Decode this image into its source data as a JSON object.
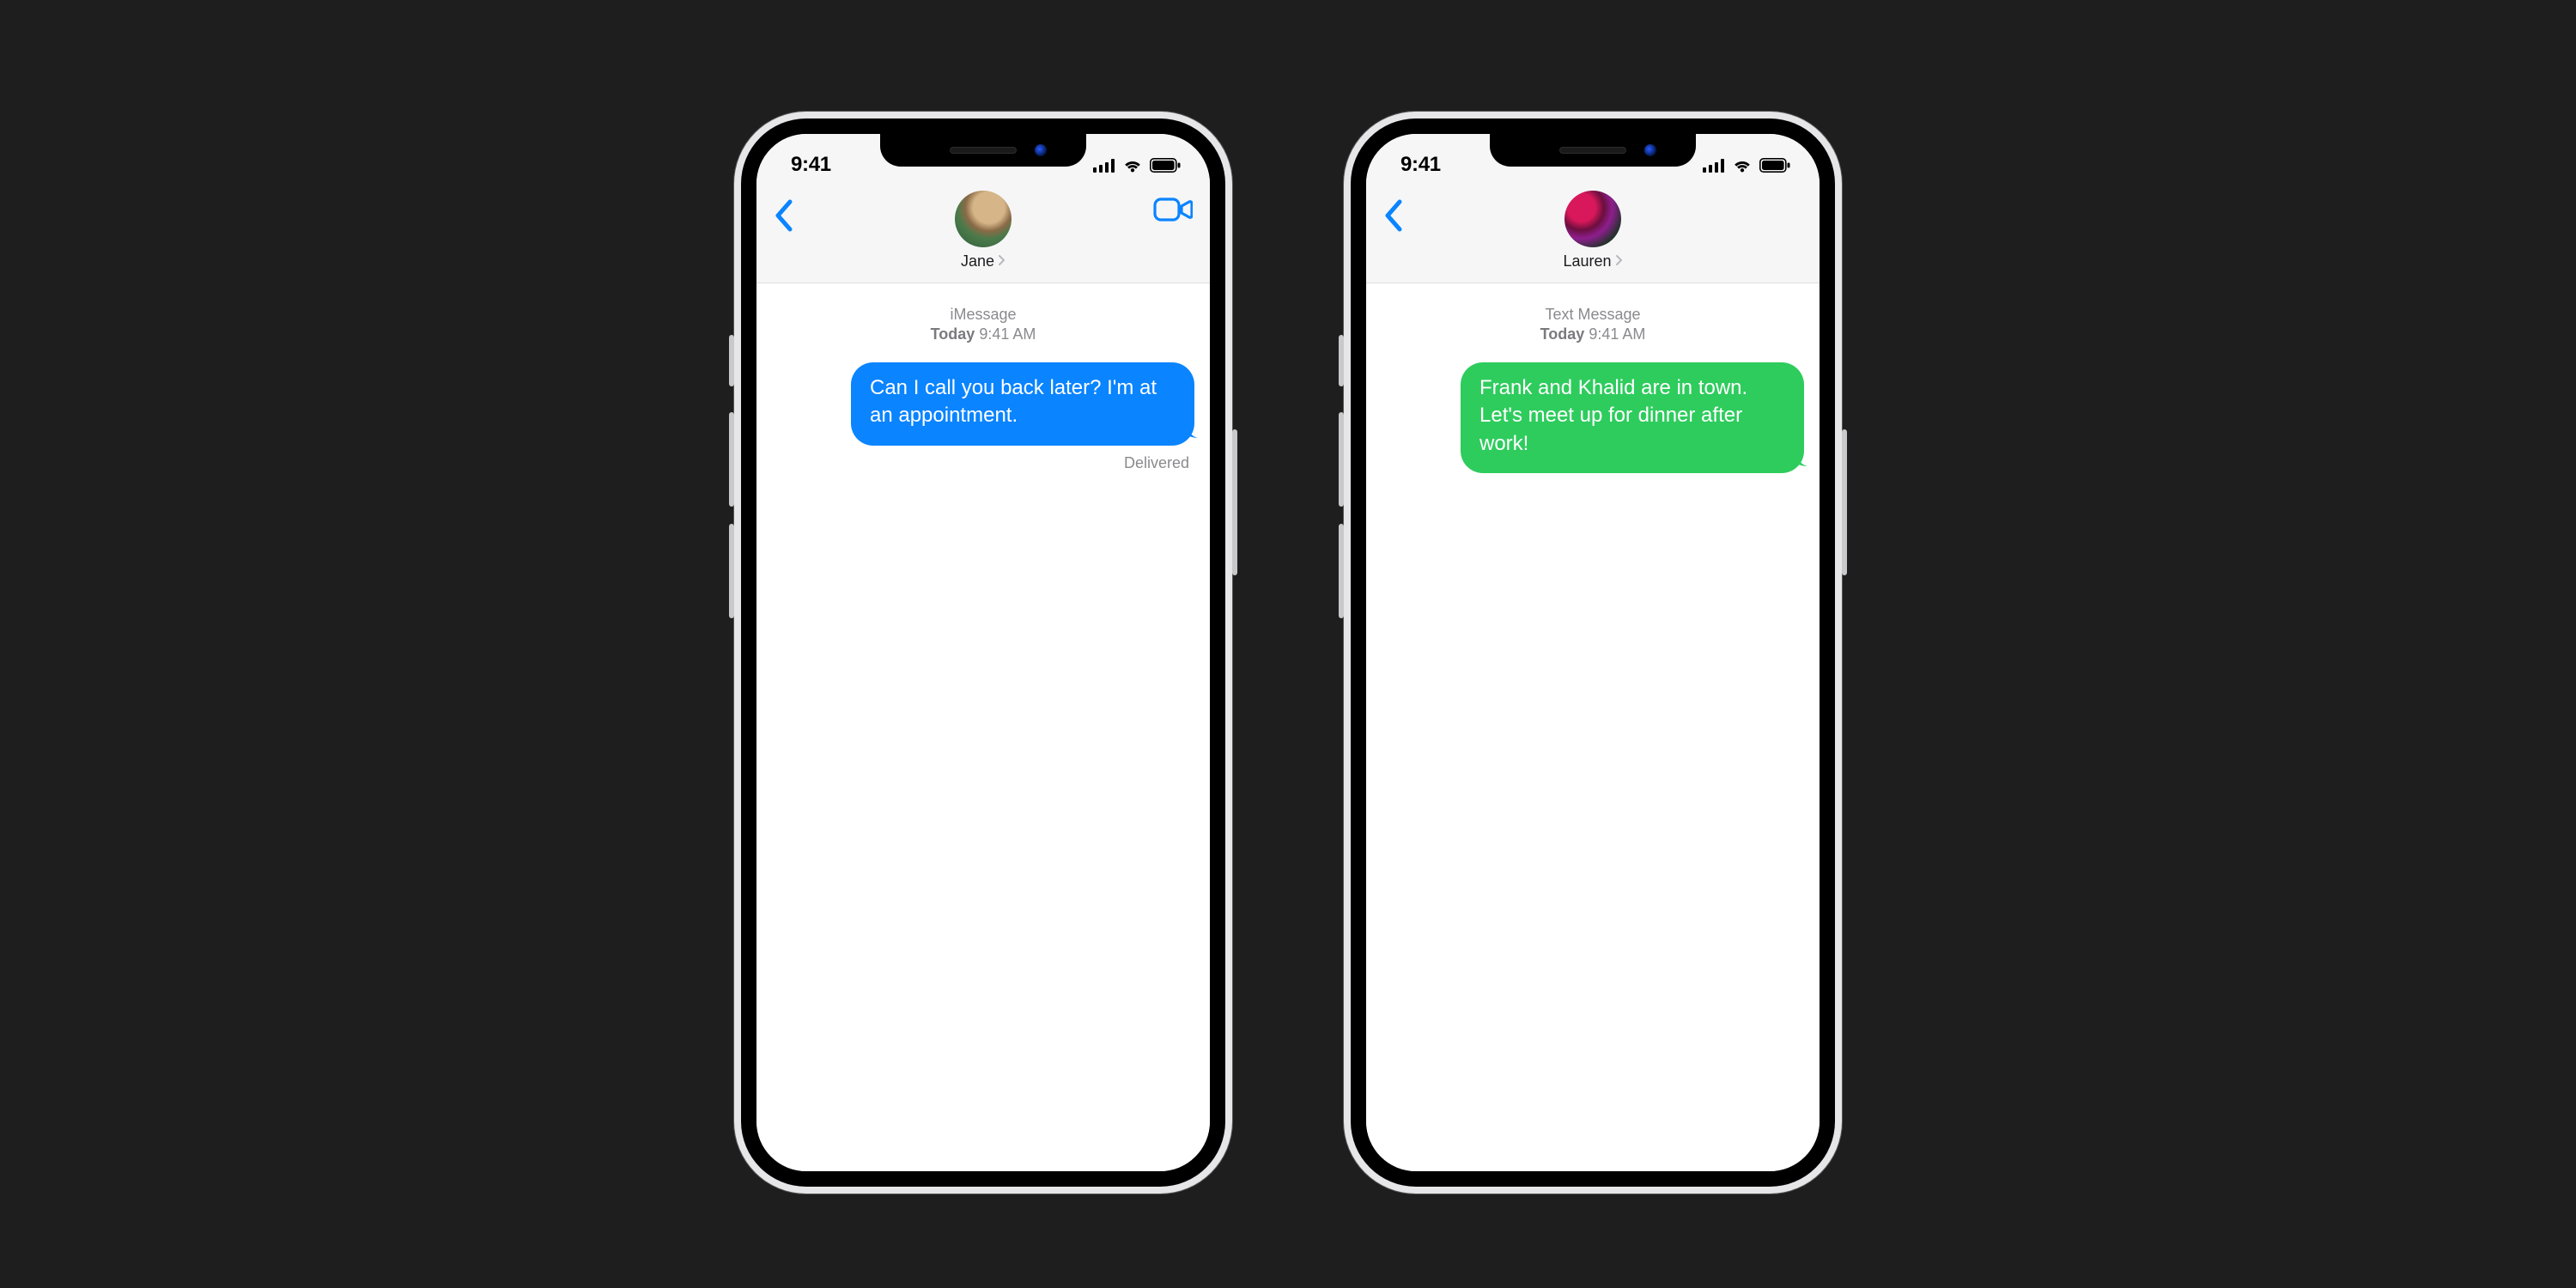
{
  "status_bar": {
    "time": "9:41"
  },
  "phones": {
    "left": {
      "contact_name": "Jane",
      "protocol_label": "iMessage",
      "timestamp_day": "Today",
      "timestamp_clock": "9:41 AM",
      "bubble_color": "#0a84ff",
      "message": "Can I call you back later? I'm at an appointment.",
      "delivery_status": "Delivered",
      "show_facetime": true
    },
    "right": {
      "contact_name": "Lauren",
      "protocol_label": "Text Message",
      "timestamp_day": "Today",
      "timestamp_clock": "9:41 AM",
      "bubble_color": "#2ecc5d",
      "message": "Frank and Khalid are in town. Let's meet up for dinner after work!",
      "delivery_status": "",
      "show_facetime": false
    }
  }
}
